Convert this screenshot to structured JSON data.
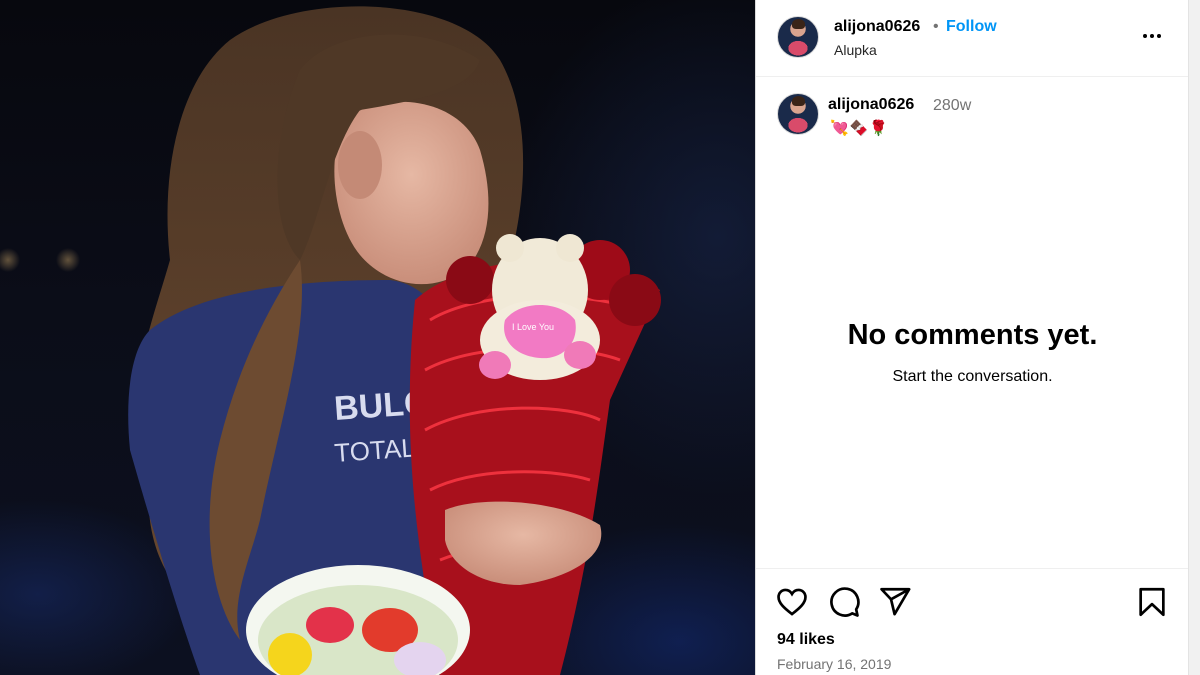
{
  "post": {
    "username": "alijona0626",
    "follow_label": "Follow",
    "separator": "•",
    "location": "Alupka"
  },
  "caption": {
    "username": "alijona0626",
    "time": "280w",
    "emoji": [
      "💘",
      "🍫",
      "🌹"
    ]
  },
  "comments": {
    "empty_title": "No comments yet.",
    "empty_subtitle": "Start the conversation."
  },
  "actions": {
    "likes": "94 likes",
    "date": "February 16, 2019"
  },
  "photo": {
    "shirt_text_1": "BULG",
    "shirt_text_2": "TOTAL",
    "toy_text": "I Love You"
  },
  "icons": {
    "like": "heart-icon",
    "comment": "comment-icon",
    "share": "share-icon",
    "save": "bookmark-icon",
    "more": "more-options-icon"
  },
  "colors": {
    "follow_blue": "#0095f6",
    "muted_text": "#737373"
  }
}
